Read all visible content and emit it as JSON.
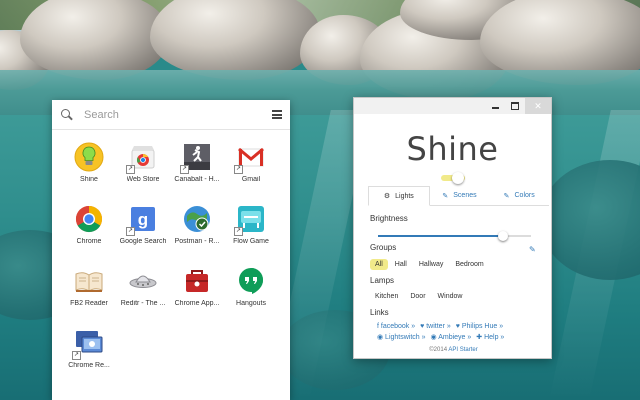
{
  "launcher": {
    "search_placeholder": "Search",
    "apps": [
      {
        "label": "Shine",
        "icon": "lightbulb-icon",
        "shortcut": false
      },
      {
        "label": "Web Store",
        "icon": "web-store-icon",
        "shortcut": true
      },
      {
        "label": "Canabalt - H...",
        "icon": "canabalt-icon",
        "shortcut": true
      },
      {
        "label": "Gmail",
        "icon": "gmail-icon",
        "shortcut": true
      },
      {
        "label": "Chrome",
        "icon": "chrome-icon",
        "shortcut": false
      },
      {
        "label": "Google Search",
        "icon": "google-search-icon",
        "shortcut": true
      },
      {
        "label": "Postman - R...",
        "icon": "postman-icon",
        "shortcut": false
      },
      {
        "label": "Flow Game",
        "icon": "flow-game-icon",
        "shortcut": true
      },
      {
        "label": "FB2 Reader",
        "icon": "fb2-reader-icon",
        "shortcut": false
      },
      {
        "label": "Reditr - The ...",
        "icon": "reditr-icon",
        "shortcut": false
      },
      {
        "label": "Chrome App...",
        "icon": "chrome-app-launcher-icon",
        "shortcut": false
      },
      {
        "label": "Hangouts",
        "icon": "hangouts-icon",
        "shortcut": false
      },
      {
        "label": "Chrome Re...",
        "icon": "chrome-remote-desktop-icon",
        "shortcut": true
      }
    ]
  },
  "shine": {
    "title": "Shine",
    "power_on": true,
    "window_close": "✕",
    "tabs": [
      {
        "label": "Lights",
        "icon": "gear-icon",
        "glyph": "⚙",
        "active": true
      },
      {
        "label": "Scenes",
        "icon": "brush-icon",
        "glyph": "✎",
        "active": false
      },
      {
        "label": "Colors",
        "icon": "eyedropper-icon",
        "glyph": "✎",
        "active": false
      }
    ],
    "brightness_label": "Brightness",
    "brightness_value": 0.82,
    "groups_label": "Groups",
    "groups": [
      "All",
      "Hall",
      "Hallway",
      "Bedroom"
    ],
    "active_group": "All",
    "lamps_label": "Lamps",
    "lamps": [
      "Kitchen",
      "Door",
      "Window"
    ],
    "links_label": "Links",
    "links_row1": [
      "f facebook »",
      "♥ twitter »",
      "♥ Philips Hue »"
    ],
    "links_row2": [
      "◉ Lightswitch »",
      "◉ Ambieye »",
      "✚ Help »"
    ],
    "footer_prefix": "©2014 ",
    "footer_link": "API Starter"
  },
  "colors": {
    "accent": "#337ab7",
    "toggle": "#f1ea8a"
  }
}
